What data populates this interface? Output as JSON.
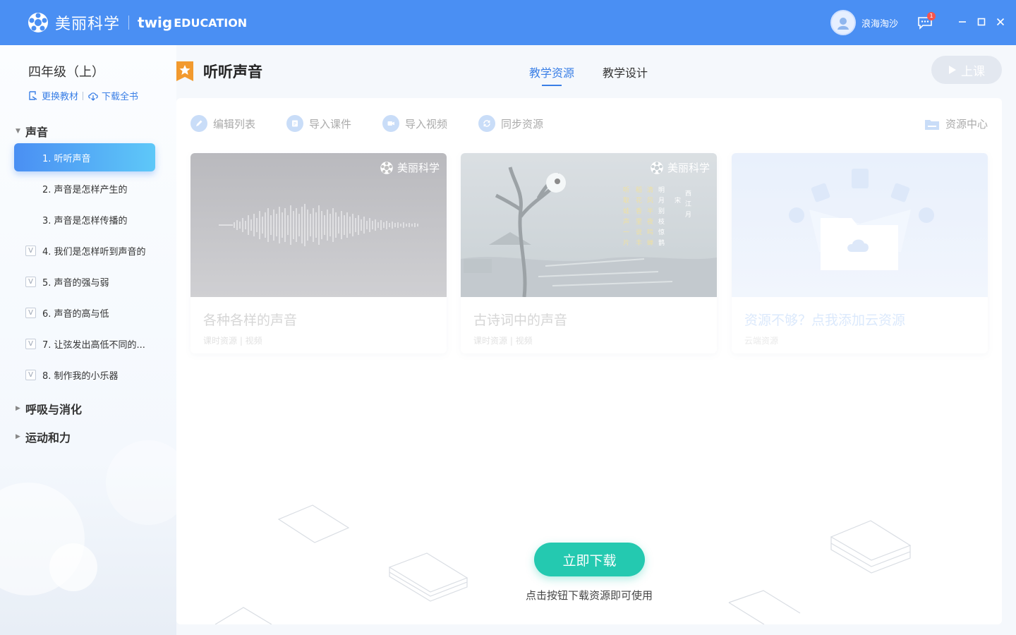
{
  "app": {
    "brand_name": "美丽科学",
    "partner_twig": "twig",
    "partner_edu": "EDUCATION",
    "user_name": "浪海淘沙",
    "message_count": "1"
  },
  "sidebar": {
    "grade": "四年级（上）",
    "change_book": "更换教材",
    "download_book": "下载全书",
    "units": [
      {
        "label": "声音",
        "expanded": true
      },
      {
        "label": "呼吸与消化",
        "expanded": false
      },
      {
        "label": "运动和力",
        "expanded": false
      }
    ],
    "lessons": [
      {
        "label": "1. 听听声音",
        "active": true,
        "checked": false
      },
      {
        "label": "2. 声音是怎样产生的",
        "active": false,
        "checked": false
      },
      {
        "label": "3. 声音是怎样传播的",
        "active": false,
        "checked": false
      },
      {
        "label": "4. 我们是怎样听到声音的",
        "active": false,
        "checked": true
      },
      {
        "label": "5. 声音的强与弱",
        "active": false,
        "checked": true
      },
      {
        "label": "6. 声音的高与低",
        "active": false,
        "checked": true
      },
      {
        "label": "7. 让弦发出高低不同的...",
        "active": false,
        "checked": true
      },
      {
        "label": "8. 制作我的小乐器",
        "active": false,
        "checked": true
      }
    ],
    "check_mark": "V"
  },
  "header": {
    "lesson_title": "听听声音",
    "tabs": [
      {
        "label": "教学资源",
        "active": true
      },
      {
        "label": "教学设计",
        "active": false
      }
    ],
    "class_button": "上课"
  },
  "toolbar": {
    "edit_list": "编辑列表",
    "import_courseware": "导入课件",
    "import_video": "导入视频",
    "sync_resources": "同步资源",
    "resource_center": "资源中心"
  },
  "cards": [
    {
      "title": "各种各样的声音",
      "meta": "课时资源 | 视频",
      "logo": "美丽科学"
    },
    {
      "title": "古诗词中的声音",
      "meta": "课时资源 | 视频",
      "logo": "美丽科学"
    },
    {
      "title": "资源不够？点我添加云资源",
      "meta": "云端资源"
    }
  ],
  "download": {
    "button": "立即下载",
    "tip": "点击按钮下载资源即可使用"
  },
  "colors": {
    "titlebar": "#4a8ff3",
    "accent": "#3a7fe6",
    "download_button": "#24c9b0",
    "badge": "#f5554d"
  }
}
